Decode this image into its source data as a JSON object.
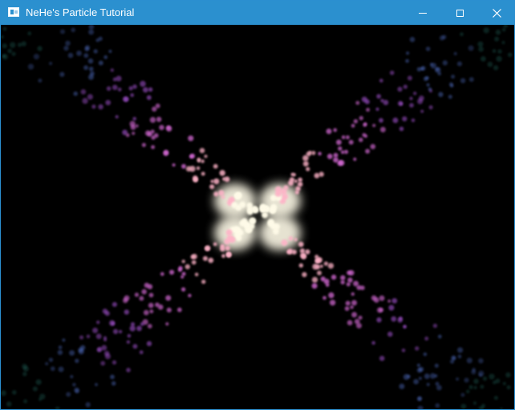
{
  "window": {
    "title": "NeHe's Particle Tutorial",
    "titlebar_color": "#2b90cf",
    "app_icon": "window-app-icon",
    "controls": [
      {
        "name": "minimize-button",
        "icon": "minimize-icon"
      },
      {
        "name": "maximize-button",
        "icon": "maximize-icon"
      },
      {
        "name": "close-button",
        "icon": "close-icon"
      }
    ]
  },
  "scene": {
    "background": "#000000",
    "particle_colors": {
      "core": "#fffbe8",
      "warm": "#ffb3c8",
      "mid": "#e06fe0",
      "outer": "#b05ae0",
      "far": "#5a7ad8",
      "tail": "#2e8a7e"
    }
  }
}
